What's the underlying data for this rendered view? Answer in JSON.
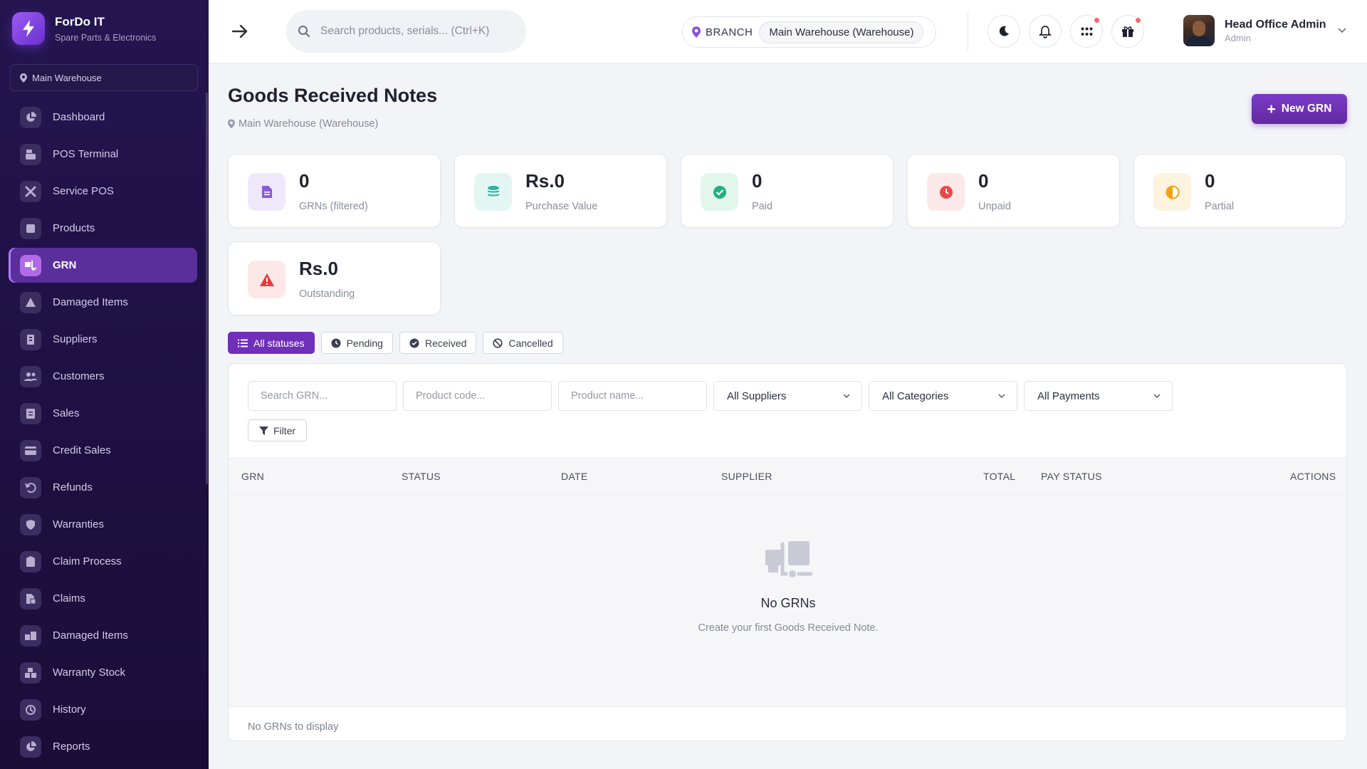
{
  "brand": {
    "title": "ForDo IT",
    "subtitle": "Spare Parts & Electronics"
  },
  "sidebar": {
    "branch": "Main Warehouse",
    "items": [
      {
        "label": "Dashboard",
        "icon": "chart-pie-icon"
      },
      {
        "label": "POS Terminal",
        "icon": "cash-register-icon"
      },
      {
        "label": "Service POS",
        "icon": "tools-icon"
      },
      {
        "label": "Products",
        "icon": "box-icon"
      },
      {
        "label": "GRN",
        "icon": "truck-loading-icon",
        "active": true
      },
      {
        "label": "Damaged Items",
        "icon": "warning-triangle-icon"
      },
      {
        "label": "Suppliers",
        "icon": "building-icon"
      },
      {
        "label": "Customers",
        "icon": "users-icon"
      },
      {
        "label": "Sales",
        "icon": "receipt-icon"
      },
      {
        "label": "Credit Sales",
        "icon": "credit-card-icon"
      },
      {
        "label": "Refunds",
        "icon": "undo-icon"
      },
      {
        "label": "Warranties",
        "icon": "shield-icon"
      },
      {
        "label": "Claim Process",
        "icon": "clipboard-icon"
      },
      {
        "label": "Claims",
        "icon": "file-claim-icon"
      },
      {
        "label": "Damaged Items",
        "icon": "damaged-boxes-icon"
      },
      {
        "label": "Warranty Stock",
        "icon": "stock-boxes-icon"
      },
      {
        "label": "History",
        "icon": "history-icon"
      },
      {
        "label": "Reports",
        "icon": "chart-pie-icon"
      }
    ]
  },
  "topbar": {
    "search_placeholder": "Search products, serials... (Ctrl+K)",
    "branch_label": "BRANCH",
    "branch_value": "Main Warehouse (Warehouse)",
    "user_name": "Head Office Admin",
    "user_role": "Admin"
  },
  "page": {
    "title": "Goods Received Notes",
    "location": "Main Warehouse (Warehouse)",
    "new_button": "New GRN"
  },
  "stats": [
    {
      "value": "0",
      "label": "GRNs (filtered)",
      "icon": "document-icon",
      "color": "#8a5cd6",
      "bg": "#efe8fb"
    },
    {
      "value": "Rs.0",
      "label": "Purchase Value",
      "icon": "coins-icon",
      "color": "#2bb3a0",
      "bg": "#e3f6f3"
    },
    {
      "value": "0",
      "label": "Paid",
      "icon": "check-circle-icon",
      "color": "#22b07d",
      "bg": "#e2f6ee"
    },
    {
      "value": "0",
      "label": "Unpaid",
      "icon": "clock-icon",
      "color": "#ea4a4a",
      "bg": "#fde9e9"
    },
    {
      "value": "0",
      "label": "Partial",
      "icon": "half-circle-icon",
      "color": "#f2a314",
      "bg": "#fef3de"
    },
    {
      "value": "Rs.0",
      "label": "Outstanding",
      "icon": "warning-triangle-icon",
      "color": "#e53b3b",
      "bg": "#fde8e8"
    }
  ],
  "status_tabs": [
    {
      "label": "All statuses",
      "icon": "list-icon",
      "active": true
    },
    {
      "label": "Pending",
      "icon": "clock-icon"
    },
    {
      "label": "Received",
      "icon": "check-circle-icon"
    },
    {
      "label": "Cancelled",
      "icon": "ban-icon"
    }
  ],
  "filters": {
    "search_grn_placeholder": "Search GRN...",
    "product_code_placeholder": "Product code...",
    "product_name_placeholder": "Product name...",
    "supplier": "All Suppliers",
    "category": "All Categories",
    "payment": "All Payments",
    "filter_button": "Filter"
  },
  "table": {
    "columns": [
      "GRN",
      "STATUS",
      "DATE",
      "SUPPLIER",
      "TOTAL",
      "PAY STATUS",
      "ACTIONS"
    ],
    "empty_title": "No GRNs",
    "empty_subtitle": "Create your first Goods Received Note.",
    "footer": "No GRNs to display"
  }
}
